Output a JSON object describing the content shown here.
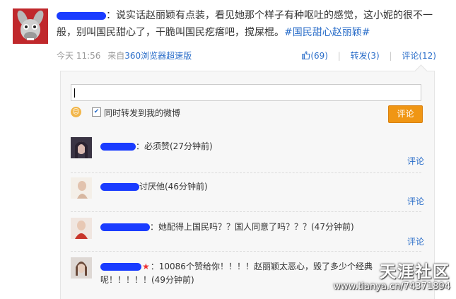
{
  "post": {
    "text": "：说实话赵丽颖有点装，看见她那个样子有种呕吐的感觉，这小妮的很不一般，别叫国民甜心了，干脆叫国民疙瘩吧，搅屎棍。",
    "hashtag": "#国民甜心赵丽颖#",
    "time": "今天 11:56",
    "source_prefix": "来自",
    "source": "360浏览器超速版",
    "likes": "(69)",
    "repost": "转发(3)",
    "comment": "评论(12)"
  },
  "composer": {
    "input_value": "",
    "repost_checked": true,
    "repost_label": "同时转发到我的微博",
    "submit_label": "评论"
  },
  "comments": [
    {
      "text": "：必须赞(27分钟前)",
      "reply": "评论"
    },
    {
      "text": "讨厌他(46分钟前)",
      "reply": "评论"
    },
    {
      "text": "：她配得上国民吗？？国人同意了吗？？？(47分钟前)",
      "reply": "评论"
    },
    {
      "text": "：10086个赞给你！！！！赵丽颖太恶心，毁了多少个经典呢！！！！！(49分钟前)",
      "reply": "评论"
    }
  ],
  "watermark": {
    "logo": "天涯社区",
    "url": "www.tianya.cn/74371894"
  },
  "colors": {
    "link": "#2b6ec9",
    "accent": "#f09614",
    "redaction": "#1a3cff",
    "avatar_bg": "#c0282c"
  },
  "icons": [
    "donkey-avatar",
    "thumbs-up-icon",
    "smiley-icon",
    "checkbox-icon",
    "star-icon"
  ]
}
